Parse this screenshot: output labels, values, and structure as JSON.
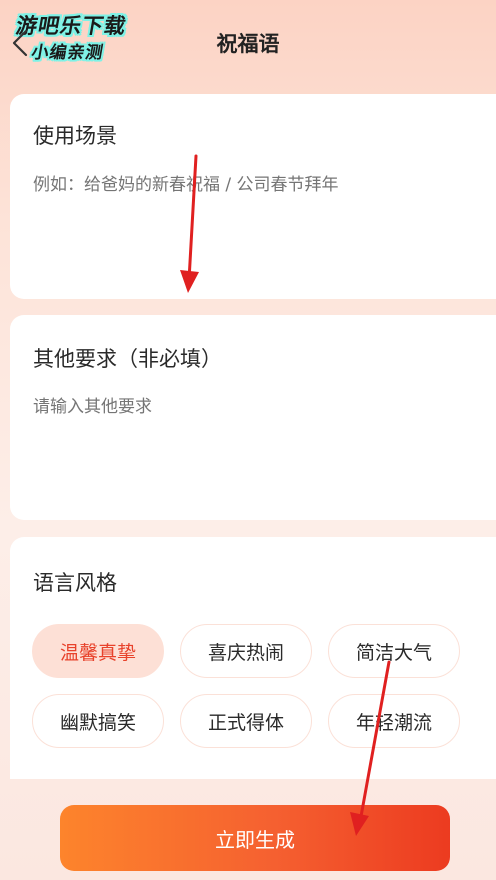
{
  "header": {
    "title": "祝福语",
    "back_icon": "chevron-left-icon"
  },
  "watermark": {
    "line1": "游吧乐下载",
    "line2": "小编亲测"
  },
  "scene": {
    "title": "使用场景",
    "placeholder": "例如：给爸妈的新春祝福 / 公司春节拜年"
  },
  "other": {
    "title": "其他要求（非必填）",
    "placeholder": "请输入其他要求"
  },
  "style": {
    "title": "语言风格",
    "options": [
      "温馨真挚",
      "喜庆热闹",
      "简洁大气",
      "幽默搞笑",
      "正式得体",
      "年轻潮流"
    ],
    "selected": "温馨真挚"
  },
  "generate_label": "立即生成",
  "colors": {
    "accent": "#e8422b",
    "selected_bg": "#fde0d6",
    "button_start": "#fd842c",
    "button_end": "#ec3b20",
    "annotation_arrow": "#e02020"
  }
}
